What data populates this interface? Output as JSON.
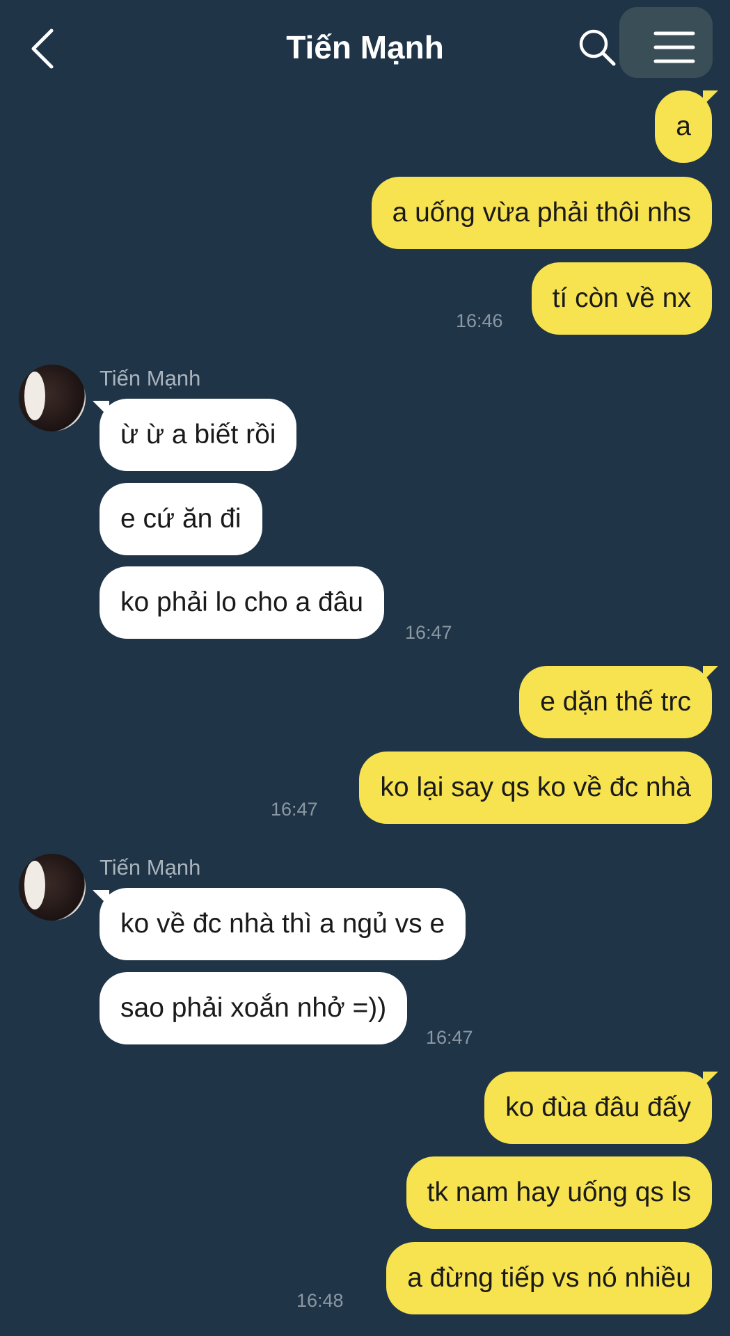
{
  "header": {
    "title": "Tiến Mạnh",
    "back_icon": "chevron-left-icon",
    "search_icon": "search-icon",
    "menu_icon": "hamburger-menu-icon"
  },
  "colors": {
    "background": "#1f3447",
    "outgoing_bubble": "#f7e24f",
    "incoming_bubble": "#ffffff",
    "timestamp": "#8b98a3"
  },
  "messages": [
    {
      "id": "m1",
      "direction": "out",
      "text": "a"
    },
    {
      "id": "m2",
      "direction": "out",
      "text": "a uống vừa phải thôi nhs"
    },
    {
      "id": "m3",
      "direction": "out",
      "text": "tí còn về nx",
      "time": "16:46"
    },
    {
      "id": "g1",
      "sender": "Tiến Mạnh"
    },
    {
      "id": "m4",
      "direction": "in",
      "text": "ừ ừ a biết rồi"
    },
    {
      "id": "m5",
      "direction": "in",
      "text": "e cứ ăn đi"
    },
    {
      "id": "m6",
      "direction": "in",
      "text": "ko phải lo cho a đâu",
      "time": "16:47"
    },
    {
      "id": "m7",
      "direction": "out",
      "text": "e dặn thế trc"
    },
    {
      "id": "m8",
      "direction": "out",
      "text": "ko lại say qs ko về đc nhà",
      "time": "16:47"
    },
    {
      "id": "g2",
      "sender": "Tiến Mạnh"
    },
    {
      "id": "m9",
      "direction": "in",
      "text": "ko về đc nhà thì a ngủ vs e"
    },
    {
      "id": "m10",
      "direction": "in",
      "text": "sao phải xoắn nhở =))",
      "time": "16:47"
    },
    {
      "id": "m11",
      "direction": "out",
      "text": "ko đùa đâu đấy"
    },
    {
      "id": "m12",
      "direction": "out",
      "text": "tk nam hay uống qs ls"
    },
    {
      "id": "m13",
      "direction": "out",
      "text": "a đừng tiếp vs nó nhiều",
      "time": "16:48"
    }
  ]
}
